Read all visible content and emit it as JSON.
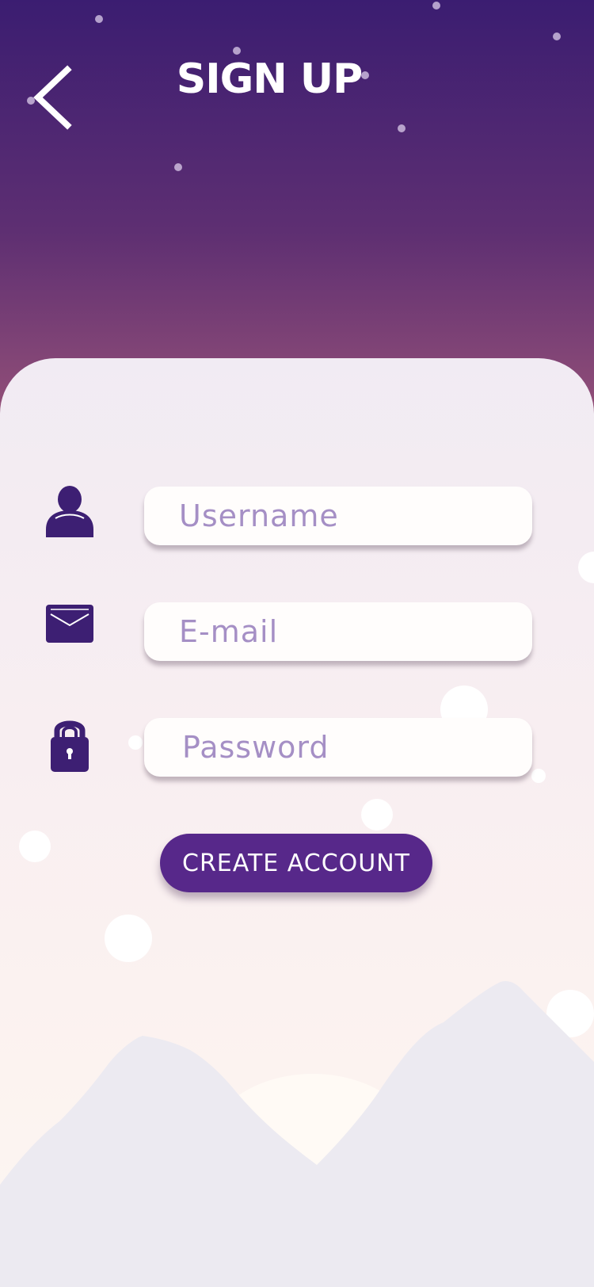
{
  "header": {
    "title": "SIGN UP",
    "back_icon": "chevron-left-icon"
  },
  "form": {
    "username": {
      "placeholder": "Username",
      "value": "",
      "icon": "user-icon"
    },
    "email": {
      "placeholder": "E-mail",
      "value": "",
      "icon": "envelope-icon"
    },
    "password": {
      "placeholder": "Password",
      "value": "",
      "icon": "lock-icon"
    },
    "submit_label": "CREATE ACCOUNT"
  },
  "colors": {
    "accent": "#57288a",
    "header_top": "#3b1d71",
    "header_bottom": "#a85a77",
    "placeholder": "#a58fc5"
  }
}
